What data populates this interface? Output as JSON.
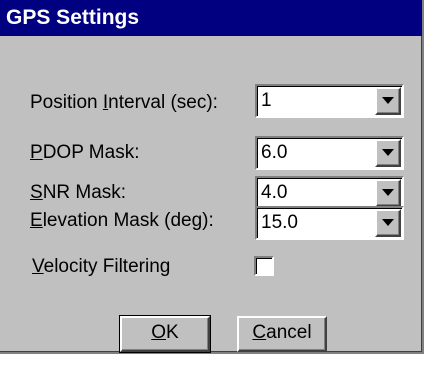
{
  "window": {
    "title": "GPS Settings"
  },
  "fields": [
    {
      "label_pre": "Position ",
      "label_key": "I",
      "label_post": "nterval (sec):",
      "value": "1"
    },
    {
      "label_pre": "",
      "label_key": "P",
      "label_post": "DOP Mask:",
      "value": "6.0"
    },
    {
      "label_pre": "",
      "label_key": "S",
      "label_post": "NR Mask:",
      "value": "4.0"
    },
    {
      "label_pre": "",
      "label_key": "E",
      "label_post": "levation Mask (deg):",
      "value": "15.0"
    }
  ],
  "velocity": {
    "label_key": "V",
    "label_post": "elocity Filtering",
    "checked": false
  },
  "buttons": {
    "ok_key": "O",
    "ok_post": "K",
    "cancel_key": "C",
    "cancel_post": "ancel"
  },
  "icons": {
    "dropdown": "chevron-down-icon"
  },
  "colors": {
    "titlebar": "#000080",
    "dialog_bg": "#c0c0c0"
  }
}
